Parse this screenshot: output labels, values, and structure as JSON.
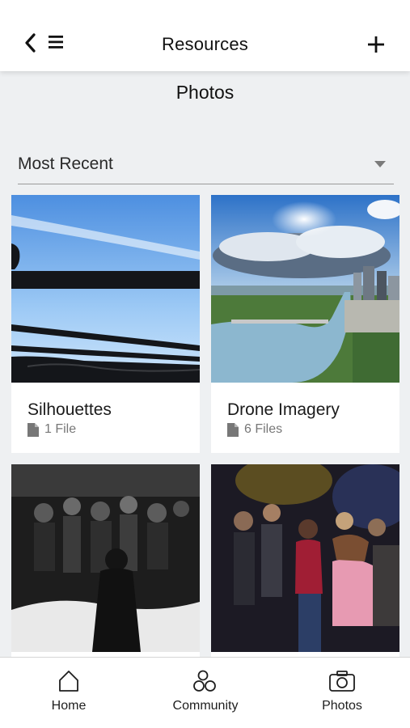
{
  "header": {
    "title": "Resources",
    "back_icon": "chevron-left-icon",
    "menu_icon": "hamburger-menu-icon",
    "add_icon": "plus-icon"
  },
  "section": {
    "title": "Photos"
  },
  "sort": {
    "selected": "Most Recent",
    "icon": "caret-down-icon"
  },
  "albums": [
    {
      "title": "Silhouettes",
      "file_count": "1 File",
      "image": "silhouette-railing-sky-photo"
    },
    {
      "title": "Drone Imagery",
      "file_count": "6 Files",
      "image": "aerial-city-river-photo"
    },
    {
      "title": "",
      "file_count": "",
      "image": "black-white-dance-party-photo"
    },
    {
      "title": "",
      "file_count": "",
      "image": "nightclub-crowd-photo"
    }
  ],
  "tabs": [
    {
      "label": "Home",
      "icon": "home-icon"
    },
    {
      "label": "Community",
      "icon": "community-icon"
    },
    {
      "label": "Photos",
      "icon": "camera-icon"
    }
  ],
  "colors": {
    "background": "#eef0f2",
    "surface": "#ffffff",
    "text": "#1f1f1f",
    "muted": "#777777"
  }
}
